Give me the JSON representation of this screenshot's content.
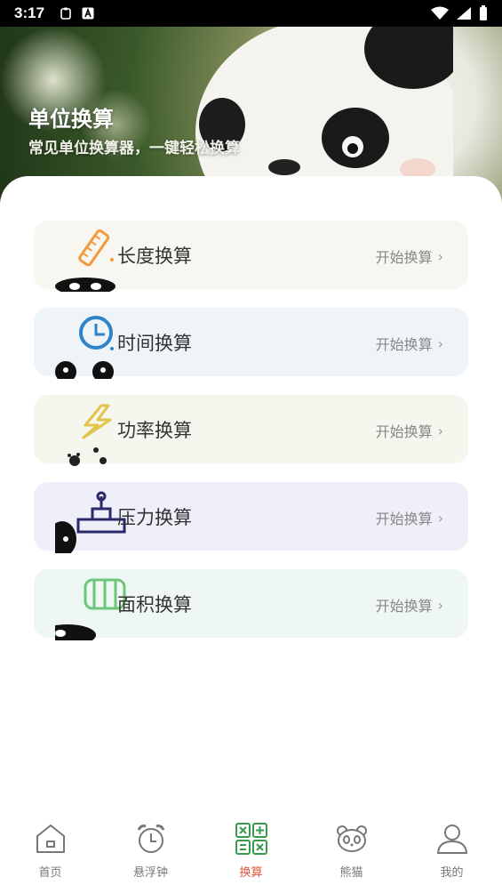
{
  "status_bar": {
    "time": "3:17"
  },
  "header": {
    "title": "单位换算",
    "subtitle": "常见单位换算器，一键轻松换算"
  },
  "cards": [
    {
      "title": "长度换算",
      "action": "开始换算",
      "bg": "#f7f6f0",
      "icon": "ruler-icon"
    },
    {
      "title": "时间换算",
      "action": "开始换算",
      "bg": "#eef4f8",
      "icon": "clock-icon"
    },
    {
      "title": "功率换算",
      "action": "开始换算",
      "bg": "#f5f6ee",
      "icon": "lightning-icon"
    },
    {
      "title": "压力换算",
      "action": "开始换算",
      "bg": "#eeeff8",
      "icon": "pressure-gauge-icon"
    },
    {
      "title": "面积换算",
      "action": "开始换算",
      "bg": "#eff7f2",
      "icon": "area-grid-icon"
    }
  ],
  "tabbar": {
    "items": [
      {
        "label": "首页",
        "icon": "home-icon"
      },
      {
        "label": "悬浮钟",
        "icon": "alarm-clock-icon"
      },
      {
        "label": "换算",
        "icon": "calculator-icon",
        "active": true
      },
      {
        "label": "熊猫",
        "icon": "panda-icon"
      },
      {
        "label": "我的",
        "icon": "user-icon"
      }
    ],
    "active_color": "#e0553c"
  }
}
